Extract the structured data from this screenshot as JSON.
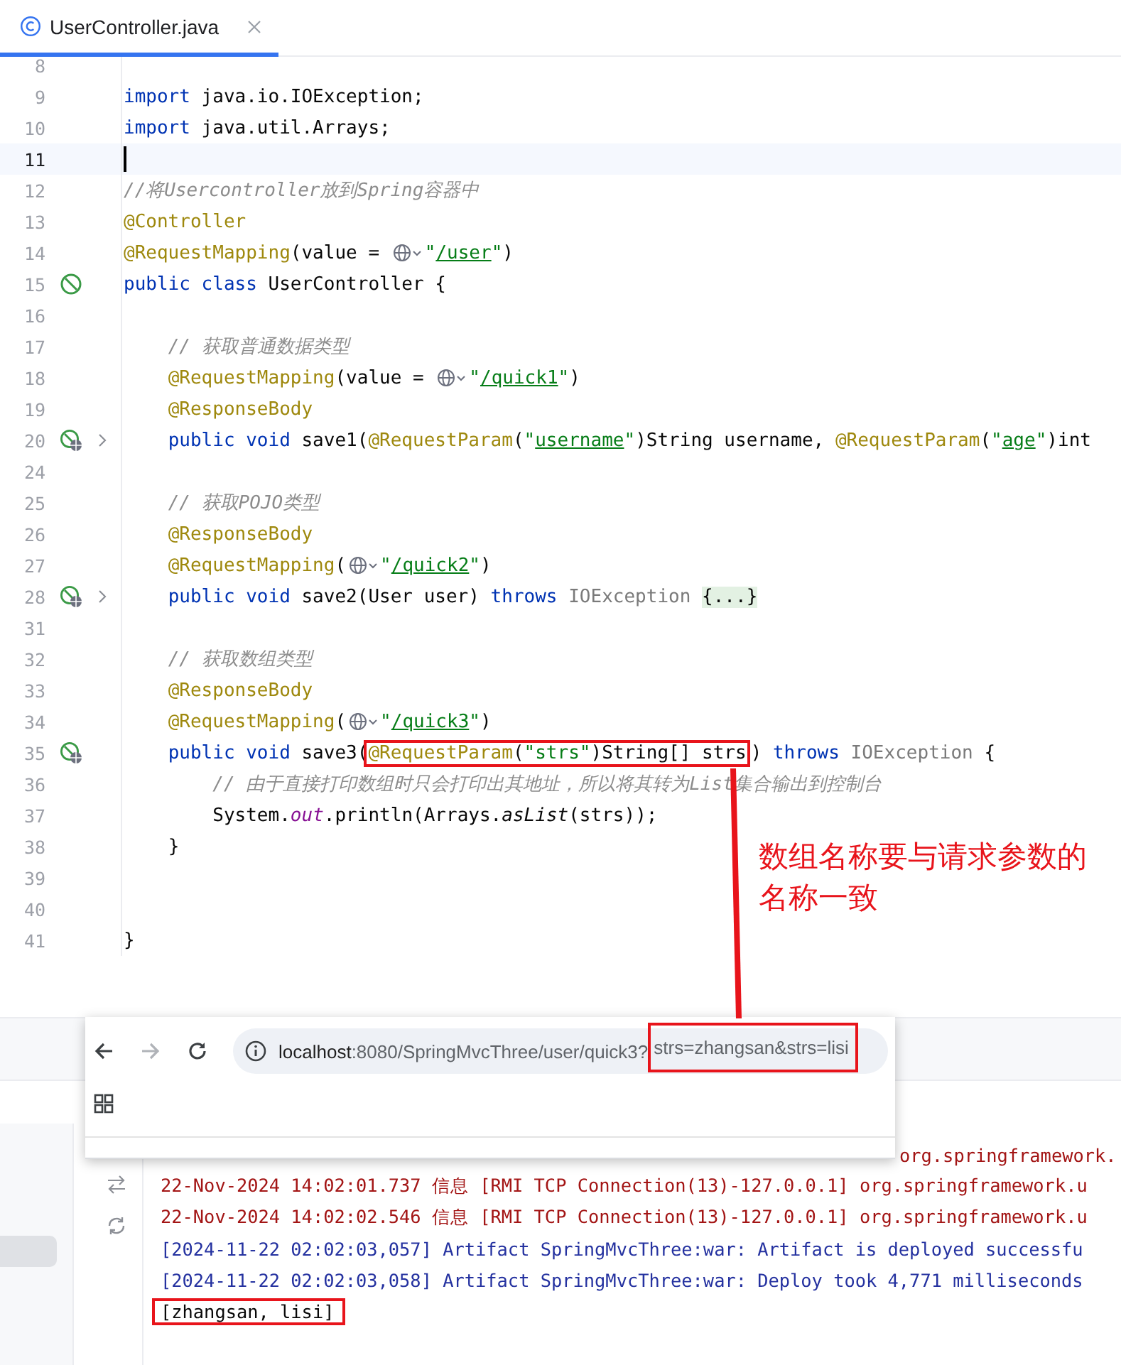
{
  "tab": {
    "title": "UserController.java",
    "selected": true
  },
  "editor": {
    "lines": [
      {
        "number": "8",
        "current": false,
        "folded": false
      },
      {
        "number": "9",
        "current": false,
        "folded": false,
        "code": [
          {
            "kind": "kw",
            "t": "import"
          },
          {
            "kind": "plain",
            "t": " java.io.IOException;"
          }
        ]
      },
      {
        "number": "10",
        "current": false,
        "folded": false,
        "code": [
          {
            "kind": "kw",
            "t": "import"
          },
          {
            "kind": "plain",
            "t": " java.util.Arrays;"
          }
        ]
      },
      {
        "number": "11",
        "current": true,
        "folded": false
      },
      {
        "number": "12",
        "current": false,
        "folded": false,
        "code": [
          {
            "kind": "cm",
            "t": "//将Usercontroller放到Spring容器中"
          }
        ]
      },
      {
        "number": "13",
        "current": false,
        "folded": false,
        "code": [
          {
            "kind": "ann",
            "t": "@Controller"
          }
        ]
      },
      {
        "number": "14",
        "current": false,
        "folded": false,
        "code": [
          {
            "kind": "ann",
            "t": "@RequestMapping"
          },
          {
            "kind": "plain",
            "t": "(value = "
          },
          {
            "kind": "globe"
          },
          {
            "kind": "str",
            "t": "\""
          },
          {
            "kind": "link",
            "t": "/user"
          },
          {
            "kind": "str",
            "t": "\""
          },
          {
            "kind": "plain",
            "t": ")"
          }
        ]
      },
      {
        "number": "15",
        "current": false,
        "folded": false,
        "marker": {
          "kind": "bean"
        },
        "code": [
          {
            "kind": "kw",
            "t": "public class"
          },
          {
            "kind": "plain",
            "t": " UserController {"
          }
        ]
      },
      {
        "number": "16",
        "current": false,
        "folded": false
      },
      {
        "number": "17",
        "current": false,
        "folded": false,
        "code": [
          {
            "kind": "cm",
            "t": "    // 获取普通数据类型"
          }
        ]
      },
      {
        "number": "18",
        "current": false,
        "folded": false,
        "code": [
          {
            "kind": "ann",
            "t": "    @RequestMapping"
          },
          {
            "kind": "plain",
            "t": "(value = "
          },
          {
            "kind": "globe"
          },
          {
            "kind": "str",
            "t": "\""
          },
          {
            "kind": "link",
            "t": "/quick1"
          },
          {
            "kind": "str",
            "t": "\""
          },
          {
            "kind": "plain",
            "t": ")"
          }
        ]
      },
      {
        "number": "19",
        "current": false,
        "folded": false,
        "code": [
          {
            "kind": "ann",
            "t": "    @ResponseBody"
          }
        ]
      },
      {
        "number": "20",
        "current": false,
        "folded": true,
        "marker": {
          "kind": "endpoint"
        },
        "code": [
          {
            "kind": "kw",
            "t": "    public void"
          },
          {
            "kind": "plain",
            "t": " save1("
          },
          {
            "kind": "ann",
            "t": "@RequestParam"
          },
          {
            "kind": "plain",
            "t": "("
          },
          {
            "kind": "str",
            "t": "\""
          },
          {
            "kind": "link",
            "t": "username"
          },
          {
            "kind": "str",
            "t": "\""
          },
          {
            "kind": "plain",
            "t": ")String username, "
          },
          {
            "kind": "ann",
            "t": "@RequestParam"
          },
          {
            "kind": "plain",
            "t": "("
          },
          {
            "kind": "str",
            "t": "\""
          },
          {
            "kind": "link",
            "t": "age"
          },
          {
            "kind": "str",
            "t": "\""
          },
          {
            "kind": "plain",
            "t": ")int"
          }
        ]
      },
      {
        "number": "24",
        "current": false,
        "folded": false
      },
      {
        "number": "25",
        "current": false,
        "folded": false,
        "code": [
          {
            "kind": "cm",
            "t": "    // 获取POJO类型"
          }
        ]
      },
      {
        "number": "26",
        "current": false,
        "folded": false,
        "code": [
          {
            "kind": "ann",
            "t": "    @ResponseBody"
          }
        ]
      },
      {
        "number": "27",
        "current": false,
        "folded": false,
        "code": [
          {
            "kind": "ann",
            "t": "    @RequestMapping"
          },
          {
            "kind": "plain",
            "t": "("
          },
          {
            "kind": "globe"
          },
          {
            "kind": "str",
            "t": "\""
          },
          {
            "kind": "link",
            "t": "/quick2"
          },
          {
            "kind": "str",
            "t": "\""
          },
          {
            "kind": "plain",
            "t": ")"
          }
        ]
      },
      {
        "number": "28",
        "current": false,
        "folded": true,
        "marker": {
          "kind": "endpoint"
        },
        "code": [
          {
            "kind": "kw",
            "t": "    public void"
          },
          {
            "kind": "plain",
            "t": " save2(User user) "
          },
          {
            "kind": "kw",
            "t": "throws"
          },
          {
            "kind": "dim",
            "t": " IOException "
          },
          {
            "kind": "fold",
            "t": "{...}"
          }
        ]
      },
      {
        "number": "31",
        "current": false,
        "folded": false
      },
      {
        "number": "32",
        "current": false,
        "folded": false,
        "code": [
          {
            "kind": "cm",
            "t": "    // 获取数组类型"
          }
        ]
      },
      {
        "number": "33",
        "current": false,
        "folded": false,
        "code": [
          {
            "kind": "ann",
            "t": "    @ResponseBody"
          }
        ]
      },
      {
        "number": "34",
        "current": false,
        "folded": false,
        "code": [
          {
            "kind": "ann",
            "t": "    @RequestMapping"
          },
          {
            "kind": "plain",
            "t": "("
          },
          {
            "kind": "globe"
          },
          {
            "kind": "str",
            "t": "\""
          },
          {
            "kind": "link",
            "t": "/quick3"
          },
          {
            "kind": "str",
            "t": "\""
          },
          {
            "kind": "plain",
            "t": ")"
          }
        ]
      },
      {
        "number": "35",
        "current": false,
        "folded": false,
        "marker": {
          "kind": "endpoint"
        },
        "code": [
          {
            "kind": "kw",
            "t": "    public void"
          },
          {
            "kind": "plain",
            "t": " save3("
          },
          {
            "kind": "box",
            "parts": [
              {
                "kind": "ann",
                "t": "@RequestParam"
              },
              {
                "kind": "plain",
                "t": "("
              },
              {
                "kind": "str",
                "t": "\"strs\""
              },
              {
                "kind": "plain",
                "t": ")String[] strs"
              }
            ]
          },
          {
            "kind": "plain",
            "t": ") "
          },
          {
            "kind": "kw",
            "t": "throws"
          },
          {
            "kind": "dim",
            "t": " IOException"
          },
          {
            "kind": "plain",
            "t": " {"
          }
        ]
      },
      {
        "number": "36",
        "current": false,
        "folded": false,
        "code": [
          {
            "kind": "cm",
            "t": "        // 由于直接打印数组时只会打印出其地址，所以将其转为List集合输出到控制台"
          }
        ]
      },
      {
        "number": "37",
        "current": false,
        "folded": false,
        "code": [
          {
            "kind": "plain",
            "t": "        System."
          },
          {
            "kind": "field",
            "t": "out"
          },
          {
            "kind": "plain",
            "t": ".println(Arrays."
          },
          {
            "kind": "ital",
            "t": "asList"
          },
          {
            "kind": "plain",
            "t": "(strs));"
          }
        ]
      },
      {
        "number": "38",
        "current": false,
        "folded": false,
        "code": [
          {
            "kind": "plain",
            "t": "    }"
          }
        ]
      },
      {
        "number": "39",
        "current": false,
        "folded": false
      },
      {
        "number": "40",
        "current": false,
        "folded": false
      },
      {
        "number": "41",
        "current": false,
        "folded": false,
        "code": [
          {
            "kind": "plain",
            "t": "}"
          }
        ]
      }
    ]
  },
  "callout": "数组名称要与请求参数的名称一致",
  "browser": {
    "host": "localhost",
    "path": ":8080/SpringMvcThree/user/quick3?",
    "query": "strs=zhangsan&strs=lisi"
  },
  "console": {
    "lines": [
      {
        "kind": "info-tail",
        "text": "org.springframework."
      },
      {
        "kind": "info",
        "text": "22-Nov-2024 14:02:01.737 信息 [RMI TCP Connection(13)-127.0.0.1] org.springframework.u"
      },
      {
        "kind": "info",
        "text": "22-Nov-2024 14:02:02.546 信息 [RMI TCP Connection(13)-127.0.0.1] org.springframework.u"
      },
      {
        "kind": "log",
        "text": "[2024-11-22 02:02:03,057] Artifact SpringMvcThree:war: Artifact is deployed successfu"
      },
      {
        "kind": "log",
        "text": "[2024-11-22 02:02:03,058] Artifact SpringMvcThree:war: Deploy took 4,771 milliseconds"
      },
      {
        "kind": "output",
        "text": "[zhangsan, lisi]"
      }
    ]
  }
}
